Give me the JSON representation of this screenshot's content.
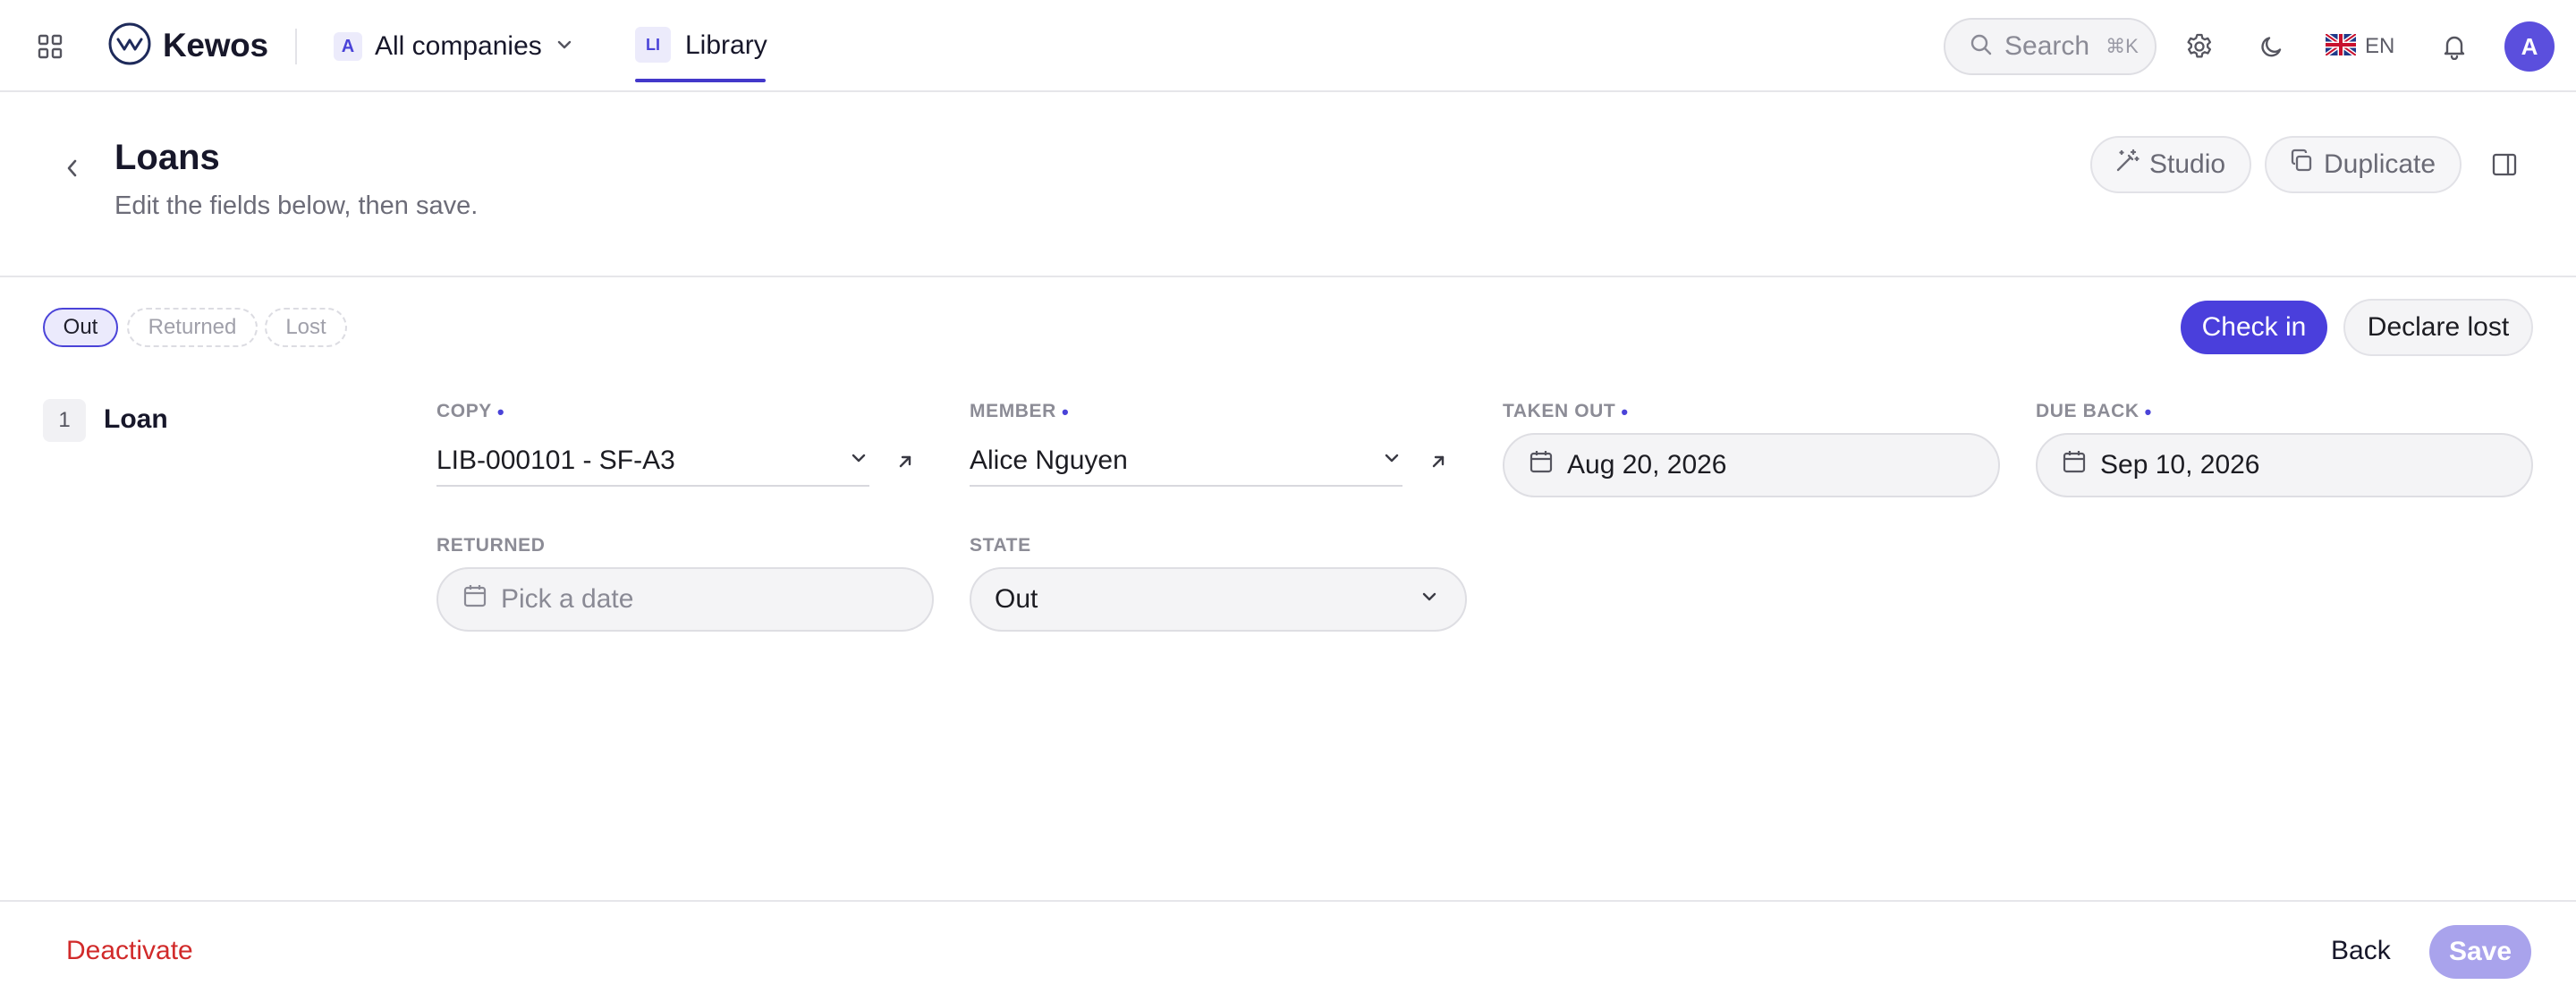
{
  "topbar": {
    "brand_name": "Kewos",
    "company": {
      "initial": "A",
      "label": "All companies"
    },
    "tab": {
      "chip": "LI",
      "label": "Library"
    },
    "search": {
      "placeholder": "Search",
      "shortcut": "⌘K"
    },
    "language": {
      "flag": "uk-flag-icon",
      "code": "EN"
    },
    "avatar_initial": "A"
  },
  "header": {
    "title": "Loans",
    "subtitle": "Edit the fields below, then save.",
    "studio_label": "Studio",
    "duplicate_label": "Duplicate"
  },
  "status": {
    "items": [
      {
        "label": "Out",
        "active": true
      },
      {
        "label": "Returned",
        "active": false
      },
      {
        "label": "Lost",
        "active": false
      }
    ],
    "check_in_label": "Check in",
    "declare_lost_label": "Declare lost"
  },
  "section": {
    "number": "1",
    "name": "Loan"
  },
  "form": {
    "copy": {
      "label": "Copy",
      "value": "LIB-000101 - SF-A3",
      "required": true
    },
    "member": {
      "label": "Member",
      "value": "Alice Nguyen",
      "required": true
    },
    "taken_out": {
      "label": "Taken out",
      "value": "Aug 20, 2026",
      "required": true
    },
    "due_back": {
      "label": "Due back",
      "value": "Sep 10, 2026",
      "required": true
    },
    "returned": {
      "label": "Returned",
      "placeholder": "Pick a date"
    },
    "state": {
      "label": "State",
      "value": "Out"
    }
  },
  "footer": {
    "deactivate_label": "Deactivate",
    "back_label": "Back",
    "save_label": "Save"
  },
  "colors": {
    "accent": "#4a3fdc",
    "danger": "#d12a2a",
    "save_disabled": "#a9a3ec"
  }
}
